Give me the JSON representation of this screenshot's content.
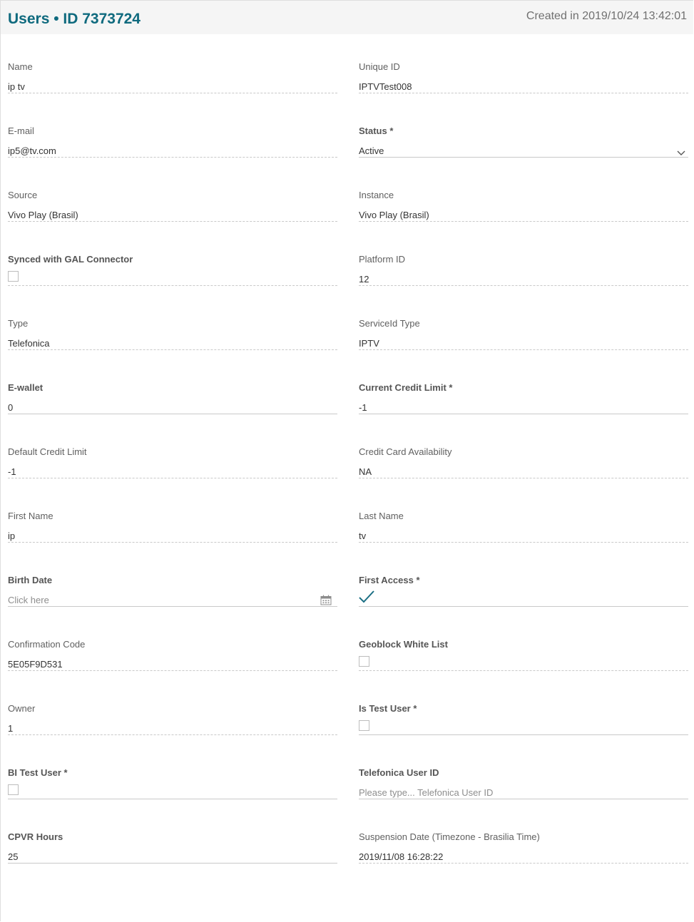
{
  "header": {
    "title": "Users • ID 7373724",
    "created": "Created in 2019/10/24 13:42:01"
  },
  "colors": {
    "title": "#0f6a7e",
    "accent": "#1b6f84"
  },
  "form": {
    "name": {
      "label": "Name",
      "value": "ip tv"
    },
    "unique_id": {
      "label": "Unique ID",
      "value": "IPTVTest008"
    },
    "email": {
      "label": "E-mail",
      "value": "ip5@tv.com"
    },
    "status": {
      "label": "Status *",
      "value": "Active",
      "icon": "chevron-down-icon"
    },
    "source": {
      "label": "Source",
      "value": "Vivo Play (Brasil)"
    },
    "instance": {
      "label": "Instance",
      "value": "Vivo Play (Brasil)"
    },
    "synced_gal": {
      "label": "Synced with GAL Connector",
      "checked": false
    },
    "platform_id": {
      "label": "Platform ID",
      "value": "12"
    },
    "type": {
      "label": "Type",
      "value": "Telefonica"
    },
    "serviceid_type": {
      "label": "ServiceId Type",
      "value": "IPTV"
    },
    "ewallet": {
      "label": "E-wallet",
      "value": "0"
    },
    "current_credit_limit": {
      "label": "Current Credit Limit *",
      "value": "-1"
    },
    "default_credit_limit": {
      "label": "Default Credit Limit",
      "value": "-1"
    },
    "credit_card_availability": {
      "label": "Credit Card Availability",
      "value": "NA"
    },
    "first_name": {
      "label": "First Name",
      "value": "ip"
    },
    "last_name": {
      "label": "Last Name",
      "value": "tv"
    },
    "birth_date": {
      "label": "Birth Date",
      "placeholder": "Click here",
      "icon": "calendar-icon"
    },
    "first_access": {
      "label": "First Access *",
      "checked": true,
      "icon": "checkmark-icon"
    },
    "confirmation_code": {
      "label": "Confirmation Code",
      "value": "5E05F9D531"
    },
    "geoblock_white_list": {
      "label": "Geoblock White List",
      "checked": false
    },
    "owner": {
      "label": "Owner",
      "value": "1"
    },
    "is_test_user": {
      "label": "Is Test User *",
      "checked": false
    },
    "bi_test_user": {
      "label": "BI Test User *",
      "checked": false
    },
    "telefonica_user_id": {
      "label": "Telefonica User ID",
      "placeholder": "Please type... Telefonica User ID"
    },
    "cpvr_hours": {
      "label": "CPVR Hours",
      "value": "25"
    },
    "suspension_date": {
      "label": "Suspension Date (Timezone - Brasilia Time)",
      "value": "2019/11/08 16:28:22"
    }
  }
}
